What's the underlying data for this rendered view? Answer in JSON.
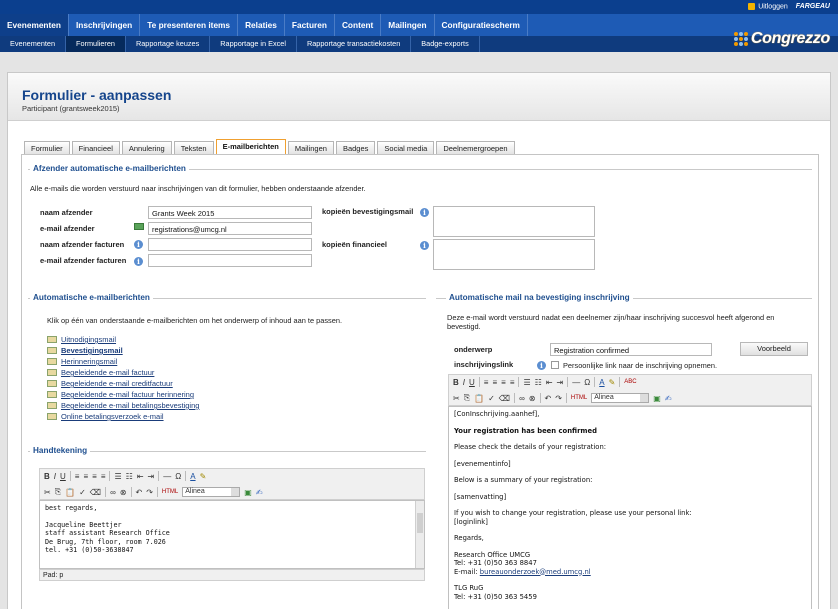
{
  "topbar": {
    "logout": "Uitloggen",
    "username": "FARGEAU"
  },
  "mainnav": [
    "Evenementen",
    "Inschrijvingen",
    "Te presenteren items",
    "Relaties",
    "Facturen",
    "Content",
    "Mailingen",
    "Configuratiescherm"
  ],
  "subnav": [
    "Evenementen",
    "Formulieren",
    "Rapportage keuzes",
    "Rapportage in Excel",
    "Rapportage transactiekosten",
    "Badge-exports"
  ],
  "logo": {
    "text": "Congrezzo"
  },
  "page": {
    "title": "Formulier - aanpassen",
    "subtitle": "Participant (grantsweek2015)"
  },
  "tabs": [
    "Formulier",
    "Financieel",
    "Annulering",
    "Teksten",
    "E-mailberichten",
    "Mailingen",
    "Badges",
    "Social media",
    "Deelnemergroepen"
  ],
  "sender": {
    "legend": "Afzender automatische e-mailberichten",
    "intro": "Alle e-mails die worden verstuurd naar inschrijvingen van dit formulier, hebben onderstaande afzender.",
    "name_label": "naam afzender",
    "name_value": "Grants Week 2015",
    "email_label": "e-mail afzender",
    "email_value": "registrations@umcg.nl",
    "inv_name_label": "naam afzender facturen",
    "inv_email_label": "e-mail afzender facturen",
    "copy_conf_label": "kopieën bevestigingsmail",
    "copy_fin_label": "kopieën financieel"
  },
  "auto": {
    "legend": "Automatische e-mailberichten",
    "intro": "Klik op één van onderstaande e-mailberichten om het onderwerp of inhoud aan te passen.",
    "links": [
      "Uitnodigingsmail",
      "Bevestigingsmail",
      "Herinneringsmail",
      "Begeleidende e-mail factuur",
      "Begeleidende e-mail creditfactuur",
      "Begeleidende e-mail factuur herinnering",
      "Begeleidende e-mail betalingsbevestiging",
      "Online betalingsverzoek e-mail"
    ]
  },
  "sig": {
    "legend": "Handtekening",
    "format": "Alinea",
    "lines": [
      "best regards,",
      "",
      "Jacqueline Beettjer",
      "staff assistant Research Office",
      "De Brug, 7th floor, room 7.026",
      "tel. +31 (0)50-3638847"
    ],
    "status": "Pad: p"
  },
  "confirm": {
    "legend": "Automatische mail na bevestiging inschrijving",
    "intro": "Deze e-mail wordt verstuurd nadat een deelnemer zijn/haar inschrijving succesvol heeft afgerond en bevestigd.",
    "subject_label": "onderwerp",
    "subject_value": "Registration confirmed",
    "preview_button": "Voorbeeld",
    "link_label": "inschrijvingslink",
    "link_checkbox": "Persoonlijke link naar de inschrijving opnemen.",
    "format": "Alinea",
    "body": {
      "l1": "[ConInschrijving.aanhef],",
      "l2": "Your registration has been confirmed",
      "l3": "Please check the details of your registration:",
      "l4": "[evenementinfo]",
      "l5": "Below is a summary of your registration:",
      "l6": "[samenvatting]",
      "l7": "If you wish to change your registration, please use your personal link:",
      "l8": "[loginlink]",
      "l9": "Regards,",
      "l10": "Research Office UMCG",
      "l11": "Tel: +31 (0)50 363 8847",
      "l12": "E-mail: ",
      "l12link": "bureauonderzoek@med.umcg.nl",
      "l13": "TLG RuG",
      "l14": "Tel: +31 (0)50 363 5459"
    }
  }
}
